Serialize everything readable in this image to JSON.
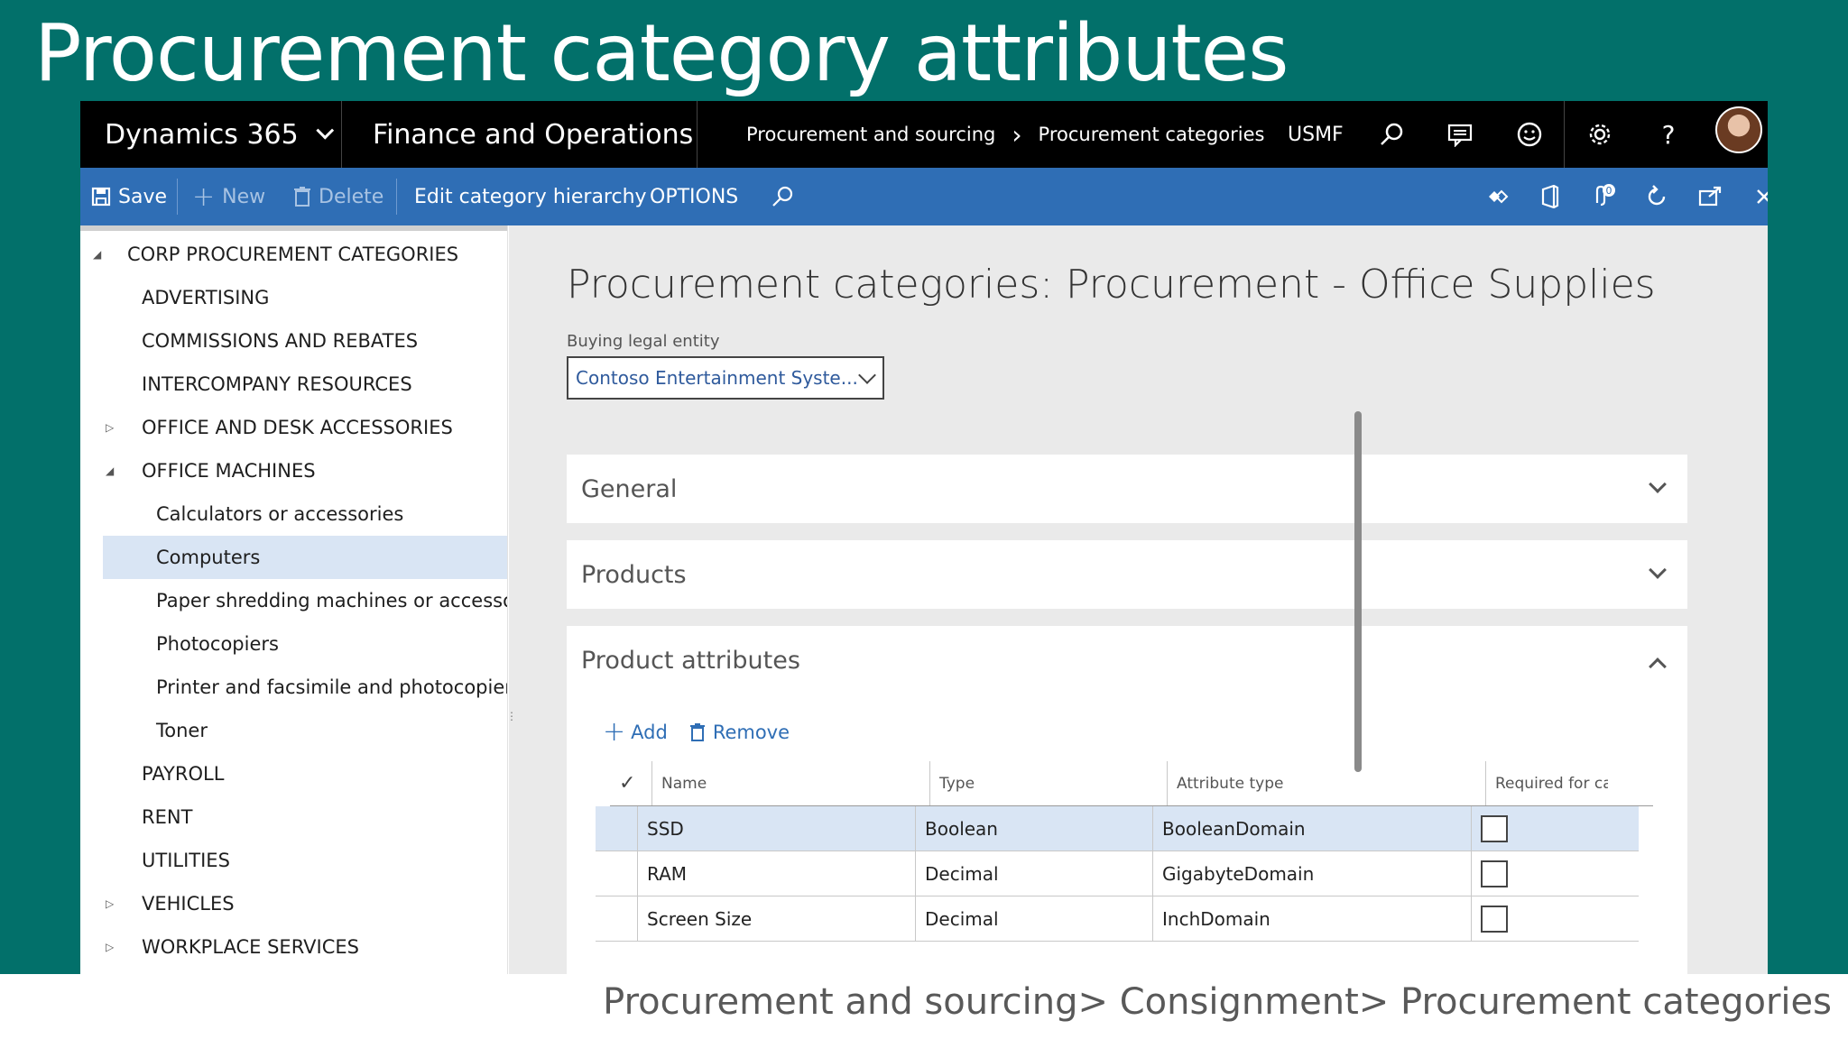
{
  "slide": {
    "title": "Procurement category attributes",
    "caption": "Procurement and sourcing> Consignment> Procurement categories"
  },
  "topbar": {
    "app_name": "Dynamics 365",
    "module": "Finance and Operations",
    "breadcrumb": [
      "Procurement and sourcing",
      "Procurement categories"
    ],
    "company": "USMF"
  },
  "actionbar": {
    "save": "Save",
    "new": "New",
    "delete": "Delete",
    "edit_hierarchy": "Edit category hierarchy",
    "options": "OPTIONS",
    "notification_count": "0"
  },
  "tree": {
    "nodes": [
      {
        "label": "CORP PROCUREMENT CATEGORIES",
        "level": 0,
        "state": "expanded"
      },
      {
        "label": "ADVERTISING",
        "level": 1,
        "state": "leaf"
      },
      {
        "label": "COMMISSIONS AND REBATES",
        "level": 1,
        "state": "leaf"
      },
      {
        "label": "INTERCOMPANY RESOURCES",
        "level": 1,
        "state": "leaf"
      },
      {
        "label": "OFFICE AND DESK ACCESSORIES",
        "level": 1,
        "state": "collapsed"
      },
      {
        "label": "OFFICE MACHINES",
        "level": 1,
        "state": "expanded"
      },
      {
        "label": "Calculators or accessories",
        "level": 2,
        "state": "leaf"
      },
      {
        "label": "Computers",
        "level": 2,
        "state": "leaf",
        "selected": true
      },
      {
        "label": "Paper shredding machines or accessories",
        "level": 2,
        "state": "leaf"
      },
      {
        "label": "Photocopiers",
        "level": 2,
        "state": "leaf"
      },
      {
        "label": "Printer and facsimile and photocopier supplies",
        "level": 2,
        "state": "leaf"
      },
      {
        "label": "Toner",
        "level": 2,
        "state": "leaf"
      },
      {
        "label": "PAYROLL",
        "level": 1,
        "state": "leaf"
      },
      {
        "label": "RENT",
        "level": 1,
        "state": "leaf"
      },
      {
        "label": "UTILITIES",
        "level": 1,
        "state": "leaf"
      },
      {
        "label": "VEHICLES",
        "level": 1,
        "state": "collapsed"
      },
      {
        "label": "WORKPLACE SERVICES",
        "level": 1,
        "state": "collapsed"
      }
    ]
  },
  "main": {
    "title": "Procurement categories: Procurement - Office Supplies",
    "buying_entity_label": "Buying legal entity",
    "buying_entity_value": "Contoso Entertainment Syste...",
    "sections": {
      "general": "General",
      "products": "Products",
      "product_attributes": "Product attributes"
    },
    "grid_tools": {
      "add": "Add",
      "remove": "Remove"
    },
    "grid": {
      "columns": [
        "Name",
        "Type",
        "Attribute type",
        "Required for ca"
      ],
      "rows": [
        {
          "name": "SSD",
          "type": "Boolean",
          "attribute_type": "BooleanDomain",
          "required": false,
          "selected": true
        },
        {
          "name": "RAM",
          "type": "Decimal",
          "attribute_type": "GigabyteDomain",
          "required": false
        },
        {
          "name": "Screen Size",
          "type": "Decimal",
          "attribute_type": "InchDomain",
          "required": false
        }
      ]
    }
  }
}
